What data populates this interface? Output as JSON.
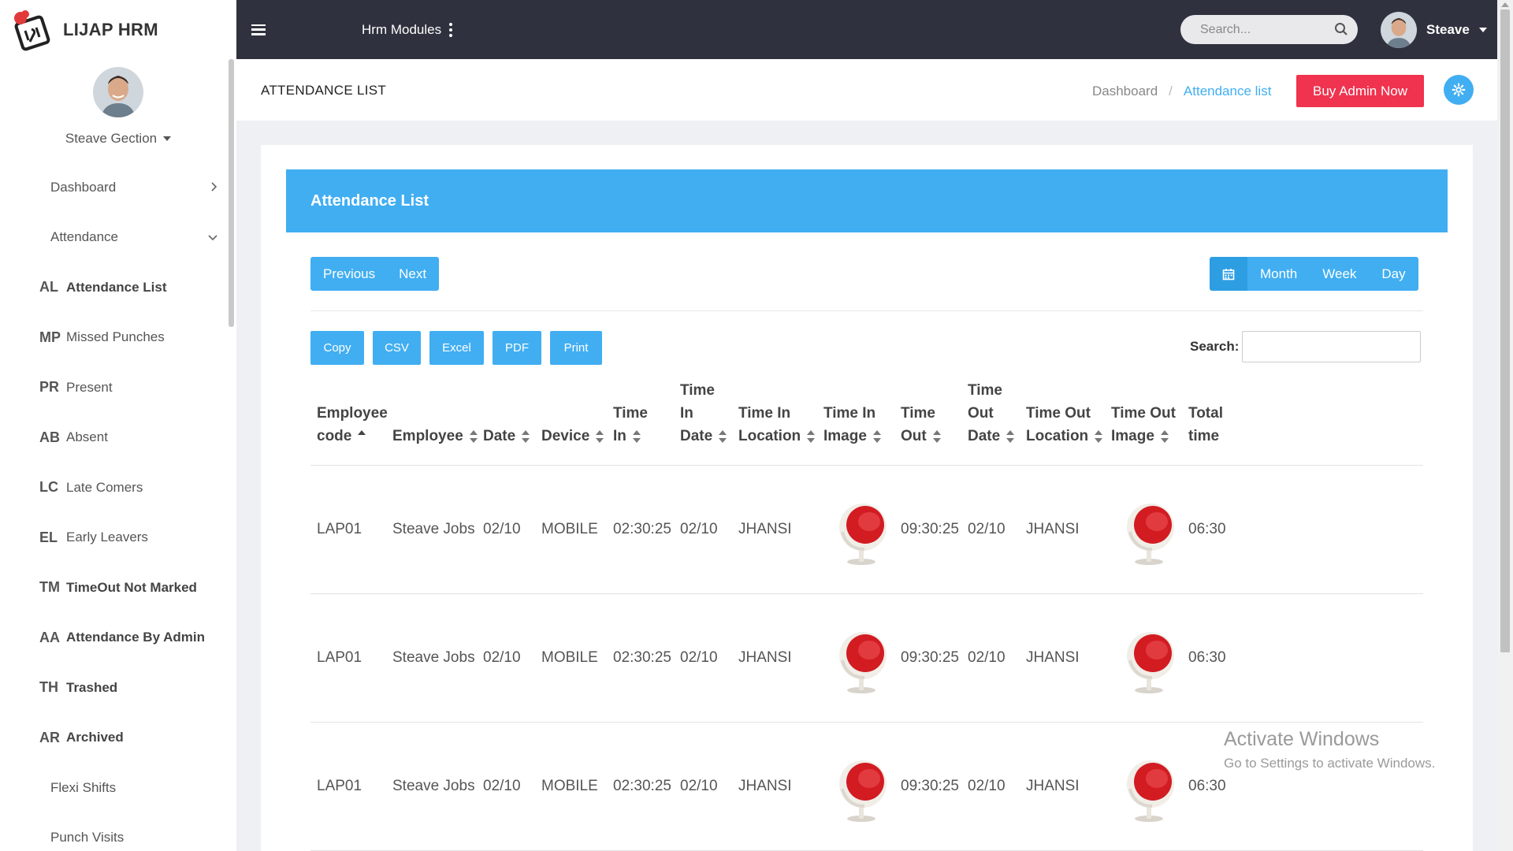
{
  "brand": {
    "name": "LIJAP HRM"
  },
  "profile": {
    "name": "Steave Gection"
  },
  "sidebar": {
    "items": [
      {
        "abbr": "",
        "label": "Dashboard",
        "chevron": "›"
      },
      {
        "abbr": "",
        "label": "Attendance",
        "chevron": "⌄"
      },
      {
        "abbr": "AL",
        "label": "Attendance List"
      },
      {
        "abbr": "MP",
        "label": "Missed Punches"
      },
      {
        "abbr": "PR",
        "label": "Present"
      },
      {
        "abbr": "AB",
        "label": "Absent"
      },
      {
        "abbr": "LC",
        "label": "Late Comers"
      },
      {
        "abbr": "EL",
        "label": "Early Leavers"
      },
      {
        "abbr": "TM",
        "label": "TimeOut Not Marked"
      },
      {
        "abbr": "AA",
        "label": "Attendance By Admin"
      },
      {
        "abbr": "TH",
        "label": "Trashed"
      },
      {
        "abbr": "AR",
        "label": "Archived"
      },
      {
        "abbr": "",
        "label": "Flexi Shifts"
      },
      {
        "abbr": "",
        "label": "Punch Visits"
      }
    ]
  },
  "topbar": {
    "modules_label": "Hrm Modules",
    "search_placeholder": "Search...",
    "user_name": "Steave"
  },
  "page": {
    "title": "ATTENDANCE LIST",
    "breadcrumb": [
      "Dashboard",
      "Attendance list"
    ],
    "buy_label": "Buy Admin Now"
  },
  "card": {
    "title": "Attendance List",
    "nav": {
      "previous": "Previous",
      "next": "Next"
    },
    "views": [
      "Month",
      "Week",
      "Day"
    ],
    "export_buttons": [
      "Copy",
      "CSV",
      "Excel",
      "PDF",
      "Print"
    ],
    "search_label": "Search:"
  },
  "table": {
    "columns": [
      [
        "Employee",
        "code"
      ],
      [
        "Employee"
      ],
      [
        "Date"
      ],
      [
        "Device"
      ],
      [
        "Time",
        "In"
      ],
      [
        "Time",
        "In",
        "Date"
      ],
      [
        "Time In",
        "Location"
      ],
      [
        "Time In",
        "Image"
      ],
      [
        "Time",
        "Out"
      ],
      [
        "Time",
        "Out",
        "Date"
      ],
      [
        "Time Out",
        "Location"
      ],
      [
        "Time Out",
        "Image"
      ],
      [
        "Total",
        "time"
      ]
    ],
    "rows": [
      {
        "code": "LAP01",
        "employee": "Steave Jobs",
        "date": "02/10",
        "device": "MOBILE",
        "time_in": "02:30:25",
        "time_in_date": "02/10",
        "time_in_location": "JHANSI",
        "time_out": "09:30:25",
        "time_out_date": "02/10",
        "time_out_location": "JHANSI",
        "total": "06:30"
      },
      {
        "code": "LAP01",
        "employee": "Steave Jobs",
        "date": "02/10",
        "device": "MOBILE",
        "time_in": "02:30:25",
        "time_in_date": "02/10",
        "time_in_location": "JHANSI",
        "time_out": "09:30:25",
        "time_out_date": "02/10",
        "time_out_location": "JHANSI",
        "total": "06:30"
      },
      {
        "code": "LAP01",
        "employee": "Steave Jobs",
        "date": "02/10",
        "device": "MOBILE",
        "time_in": "02:30:25",
        "time_in_date": "02/10",
        "time_in_location": "JHANSI",
        "time_out": "09:30:25",
        "time_out_date": "02/10",
        "time_out_location": "JHANSI",
        "total": "06:30"
      }
    ]
  },
  "watermark": {
    "line1": "Activate Windows",
    "line2": "Go to Settings to activate Windows."
  },
  "colors": {
    "accent": "#41aef2",
    "buy": "#f0334f",
    "topbar": "#2f323e"
  },
  "icons": [
    "hamburger-icon",
    "kebab-icon",
    "search-icon",
    "calendar-icon",
    "gear-icon",
    "chair-image"
  ]
}
